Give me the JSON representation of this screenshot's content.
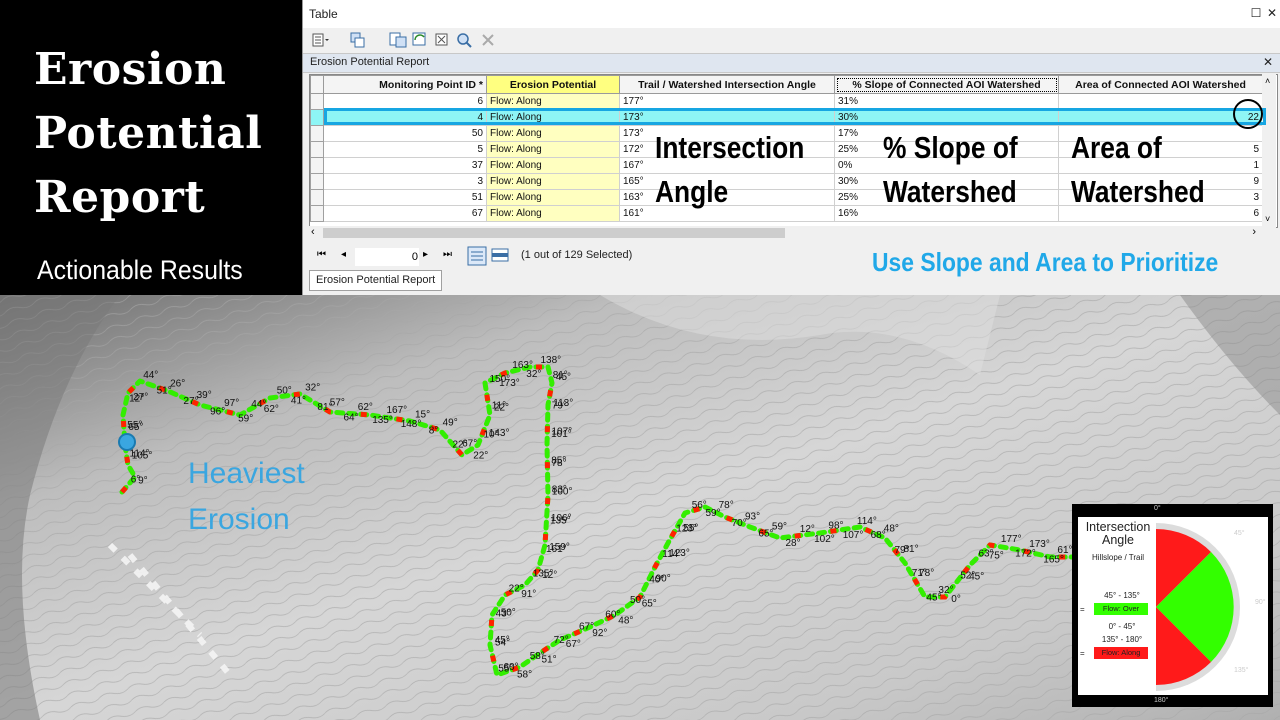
{
  "slide": {
    "title_line1": "Erosion",
    "title_line2": "Potential",
    "title_line3": "Report",
    "subtitle": "Actionable Results",
    "overlay_angle_line1": "Intersection",
    "overlay_angle_line2": "Angle",
    "overlay_slope_line1": "% Slope of",
    "overlay_slope_line2": "Watershed",
    "overlay_area_line1": "Area of",
    "overlay_area_line2": "Watershed",
    "overlay_prioritize": "Use Slope and Area to Prioritize",
    "heaviest_line1": "Heaviest",
    "heaviest_line2": "Erosion",
    "highlighted_value": "22"
  },
  "window": {
    "title": "Table",
    "tab_label": "Erosion Potential Report",
    "bottom_tab": "Erosion Potential Report",
    "record_value": "0",
    "selection_info": "(1 out of 129 Selected)",
    "toolbar_icons": [
      "table-options-icon",
      "related-tables-icon",
      "select-by-attributes-icon",
      "switch-selection-icon",
      "clear-selection-icon",
      "zoom-to-selected-icon",
      "delete-selected-icon"
    ]
  },
  "table": {
    "columns": [
      "Monitoring Point ID *",
      "Erosion Potential",
      "Trail / Watershed Intersection Angle",
      "% Slope of Connected AOI Watershed",
      "Area of Connected AOI Watershed"
    ],
    "rows": [
      {
        "id": "6",
        "potential": "Flow: Along",
        "angle": "177°",
        "slope": "31%",
        "area": ""
      },
      {
        "id": "4",
        "potential": "Flow: Along",
        "angle": "173°",
        "slope": "30%",
        "area": "22"
      },
      {
        "id": "50",
        "potential": "Flow: Along",
        "angle": "173°",
        "slope": "17%",
        "area": ""
      },
      {
        "id": "5",
        "potential": "Flow: Along",
        "angle": "172°",
        "slope": "25%",
        "area": "5"
      },
      {
        "id": "37",
        "potential": "Flow: Along",
        "angle": "167°",
        "slope": "0%",
        "area": "1"
      },
      {
        "id": "3",
        "potential": "Flow: Along",
        "angle": "165°",
        "slope": "30%",
        "area": "9"
      },
      {
        "id": "51",
        "potential": "Flow: Along",
        "angle": "163°",
        "slope": "25%",
        "area": "3"
      },
      {
        "id": "67",
        "potential": "Flow: Along",
        "angle": "161°",
        "slope": "16%",
        "area": "6"
      }
    ],
    "selected_row": 1
  },
  "legend": {
    "title_line1": "Intersection",
    "title_line2": "Angle",
    "sub": "Hillslope / Trail",
    "range_over": "45° - 135°",
    "label_over": "Flow: Over",
    "range_along1": "0° - 45°",
    "range_along2": "135° - 180°",
    "label_along": "Flow: Along",
    "tick_0": "0°",
    "tick_45": "45°",
    "tick_90": "90°",
    "tick_135": "135°",
    "tick_180": "180°",
    "eq1": "=",
    "eq2": "=",
    "color_over": "#33ff00",
    "color_along": "#ff1a1a"
  },
  "map_labels": [
    "6°",
    "9°",
    "105°",
    "114°",
    "65°",
    "55°",
    "12°",
    "27°",
    "44°",
    "51°",
    "26°",
    "27°",
    "39°",
    "96°",
    "97°",
    "59°",
    "44°",
    "62°",
    "50°",
    "41°",
    "32°",
    "81°",
    "57°",
    "64°",
    "62°",
    "135°",
    "167°",
    "148°",
    "15°",
    "8°",
    "49°",
    "22°",
    "67°",
    "22°",
    "10°",
    "143°",
    "22°",
    "11°",
    "150°",
    "173°",
    "163°",
    "32°",
    "138°",
    "81°",
    "45°",
    "113°",
    "79°",
    "107°",
    "101°",
    "85°",
    "78°",
    "83°",
    "100°",
    "106°",
    "135°",
    "159°",
    "161°",
    "12°",
    "135°",
    "91°",
    "22°",
    "50°",
    "43°",
    "45°",
    "54°",
    "55°",
    "60°",
    "58°",
    "58°",
    "51°",
    "72°",
    "67°",
    "67°",
    "92°",
    "60°",
    "48°",
    "50°",
    "65°",
    "40°",
    "90°",
    "114°",
    "123°",
    "123°",
    "55°",
    "56°",
    "59°",
    "78°",
    "70°",
    "93°",
    "65°",
    "59°",
    "28°",
    "12°",
    "102°",
    "98°",
    "107°",
    "114°",
    "68°",
    "48°",
    "79°",
    "81°",
    "71°",
    "78°",
    "45°",
    "32°",
    "0°",
    "52°",
    "45°",
    "63°",
    "75°",
    "177°",
    "172°",
    "173°",
    "165°",
    "61°",
    "50°"
  ]
}
